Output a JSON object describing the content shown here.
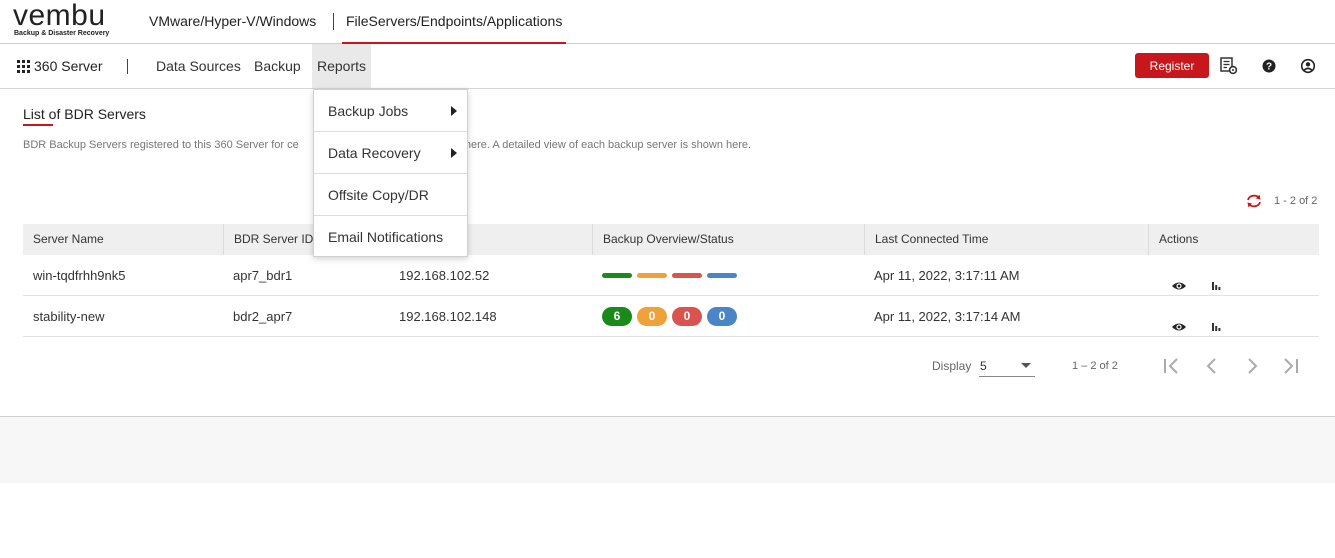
{
  "brand": {
    "logo_text": "vembu",
    "tagline": "Backup & Disaster Recovery"
  },
  "product_tabs": [
    {
      "label": "VMware/Hyper-V/Windows",
      "active": false
    },
    {
      "label": "FileServers/Endpoints/Applications",
      "active": true
    }
  ],
  "navbar": {
    "apps_icon": "apps-grid-icon",
    "app_name": "360 Server",
    "items": [
      {
        "label": "Data Sources"
      },
      {
        "label": "Backup"
      },
      {
        "label": "Reports",
        "active": true
      }
    ],
    "register_label": "Register",
    "icons": [
      "server-settings-icon",
      "help-icon",
      "user-account-icon"
    ]
  },
  "reports_menu": {
    "items": [
      {
        "label": "Backup Jobs",
        "has_submenu": true
      },
      {
        "label": "Data Recovery",
        "has_submenu": true
      },
      {
        "label": "Offsite Copy/DR",
        "has_submenu": false
      },
      {
        "label": "Email Notifications",
        "has_submenu": false
      }
    ]
  },
  "page": {
    "title": "List of BDR Servers",
    "description": "BDR Backup Servers registered to this 360 Server for ce                                       d here. A detailed view of each backup server is shown here.",
    "description_left": "BDR Backup Servers registered to this 360 Server for ce",
    "description_right": "d here. A detailed view of each backup server is shown here.",
    "range_top": "1 - 2 of 2"
  },
  "table": {
    "columns": [
      "Server Name",
      "BDR Server ID",
      "",
      "Backup Overview/Status",
      "Last Connected Time",
      "Actions"
    ],
    "rows": [
      {
        "server_name": "win-tqdfrhh9nk5",
        "bdr_id": "apr7_bdr1",
        "ip": "192.168.102.52",
        "status_type": "bars",
        "last_connected": "Apr 11, 2022, 3:17:11 AM"
      },
      {
        "server_name": "stability-new",
        "bdr_id": "bdr2_apr7",
        "ip": "192.168.102.148",
        "status_type": "counts",
        "counts": [
          "6",
          "0",
          "0",
          "0"
        ],
        "last_connected": "Apr 11, 2022, 3:17:14 AM"
      }
    ]
  },
  "status_colors": {
    "success": "#1a8a1a",
    "warning": "#f0a23a",
    "failed": "#d9534f",
    "info": "#4a86c5"
  },
  "pagination": {
    "display_label": "Display",
    "page_size": "5",
    "range": "1 – 2 of 2"
  },
  "accent_color": "#c8161d"
}
